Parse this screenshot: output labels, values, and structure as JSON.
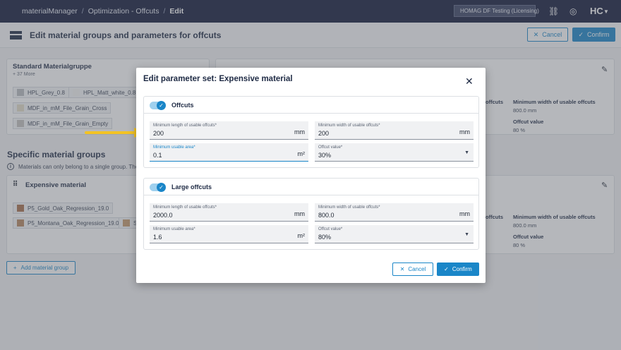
{
  "breadcrumb": {
    "app": "materialManager",
    "section": "Optimization - Offcuts",
    "current": "Edit"
  },
  "tenant": "HOMAG DF Testing (Licensing)",
  "brand": "HC",
  "page_title": "Edit material groups and parameters for offcuts",
  "header_buttons": {
    "cancel": "Cancel",
    "confirm": "Confirm"
  },
  "standard_group": {
    "title": "Standard Materialgruppe",
    "more": "+ 37 More",
    "chips": [
      {
        "label": "HPL_Grey_0.8",
        "color": "#b9bcbf"
      },
      {
        "label": "HPL_Matt_white_0.8",
        "color": "#f4f4f2"
      },
      {
        "label": "MDF_in_mM_File_Grain_Cross",
        "color": "#e3dcc6"
      },
      {
        "label": "MDF_in_mM_File_Grain_Empty",
        "color": "#c3c1bd"
      }
    ]
  },
  "specific_section": {
    "title": "Specific material groups",
    "info": "Materials can only belong to a single group. The re"
  },
  "expensive_group": {
    "title": "Expensive material",
    "chips": [
      {
        "label": "P5_Gold_Oak_Regression_19.0",
        "color": "#a8704c"
      },
      {
        "label": "P5_Montana_Oak_Regression_19.0",
        "color": "#b7875f"
      },
      {
        "label": "St",
        "color": "#c59a6b"
      }
    ]
  },
  "right_card_1": {
    "label1": "offcuts",
    "label2": "Minimum width of usable offcuts",
    "val2": "800.0 mm",
    "label3": "Offcut value",
    "val3": "80 %"
  },
  "right_card_2": {
    "label1": "offcuts",
    "label2": "Minimum width of usable offcuts",
    "val2": "800.0 mm",
    "label3": "Offcut value",
    "val3": "80 %"
  },
  "add_group_button": "Add material group",
  "modal": {
    "title": "Edit parameter set: Expensive material",
    "offcuts": {
      "title": "Offcuts",
      "min_length": {
        "label": "Minimum length of usable offcuts*",
        "value": "200",
        "unit": "mm"
      },
      "min_width": {
        "label": "Minimum width of usable offcuts*",
        "value": "200",
        "unit": "mm"
      },
      "min_area": {
        "label": "Minimum usable area*",
        "value": "0.1",
        "unit": "m²"
      },
      "offcut_value": {
        "label": "Offcut value*",
        "value": "30%"
      }
    },
    "large_offcuts": {
      "title": "Large offcuts",
      "min_length": {
        "label": "Minimum length of usable offcuts*",
        "value": "2000.0",
        "unit": "mm"
      },
      "min_width": {
        "label": "Minimum width of usable offcuts*",
        "value": "800.0",
        "unit": "mm"
      },
      "min_area": {
        "label": "Minimum usable area*",
        "value": "1.6",
        "unit": "m²"
      },
      "offcut_value": {
        "label": "Offcut value*",
        "value": "80%"
      }
    },
    "cancel": "Cancel",
    "confirm": "Confirm"
  },
  "colors": {
    "accent": "#1a86c8",
    "topbar": "#11193a",
    "arrow": "#f3c324"
  }
}
